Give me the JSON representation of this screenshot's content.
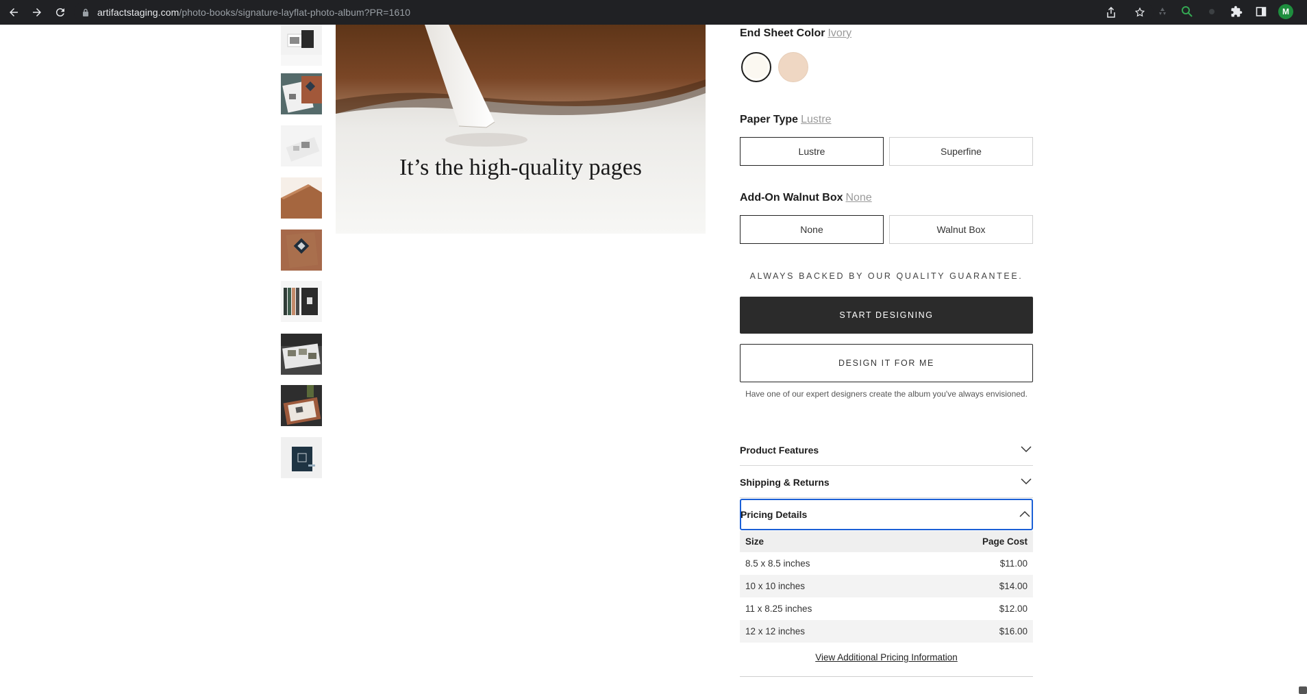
{
  "browser": {
    "url_host": "artifactstaging.com",
    "url_path": "/photo-books/signature-layflat-photo-album?PR=1610",
    "profile_initial": "M"
  },
  "gallery": {
    "thumbnails": [
      {
        "name": "thumb-album-cover-dark"
      },
      {
        "name": "thumb-album-spread-teal"
      },
      {
        "name": "thumb-album-open-white"
      },
      {
        "name": "thumb-leather-corner"
      },
      {
        "name": "thumb-album-cover-tan"
      },
      {
        "name": "thumb-album-spines"
      },
      {
        "name": "thumb-album-photos-table"
      },
      {
        "name": "thumb-album-walnut-box"
      },
      {
        "name": "thumb-album-navy-logo"
      }
    ],
    "hero_caption": "It’s the high-quality pages"
  },
  "options": {
    "end_sheet": {
      "title": "End Sheet Color",
      "value": "Ivory",
      "swatches": [
        "#fbf8f1",
        "#efd7c3"
      ]
    },
    "paper_type": {
      "title": "Paper Type",
      "value": "Lustre",
      "choices": [
        "Lustre",
        "Superfine"
      ]
    },
    "walnut_box": {
      "title": "Add-On Walnut Box",
      "value": "None",
      "choices": [
        "None",
        "Walnut Box"
      ]
    }
  },
  "cta": {
    "guarantee": "ALWAYS BACKED BY OUR QUALITY GUARANTEE.",
    "primary": "START DESIGNING",
    "secondary": "DESIGN IT FOR ME",
    "helper": "Have one of our expert designers create the album you've always envisioned."
  },
  "accordions": {
    "features": "Product Features",
    "shipping": "Shipping & Returns",
    "pricing": "Pricing Details"
  },
  "pricing": {
    "headers": [
      "Size",
      "Page Cost"
    ],
    "rows": [
      [
        "8.5 x 8.5 inches",
        "$11.00"
      ],
      [
        "10 x 10 inches",
        "$14.00"
      ],
      [
        "11 x 8.25 inches",
        "$12.00"
      ],
      [
        "12 x 12 inches",
        "$16.00"
      ]
    ],
    "view_more": "View Additional Pricing Information"
  },
  "colors": {
    "primary_button": "#2b2b2b",
    "focus_ring": "#1a5fd6",
    "browser_bar": "#202124"
  }
}
